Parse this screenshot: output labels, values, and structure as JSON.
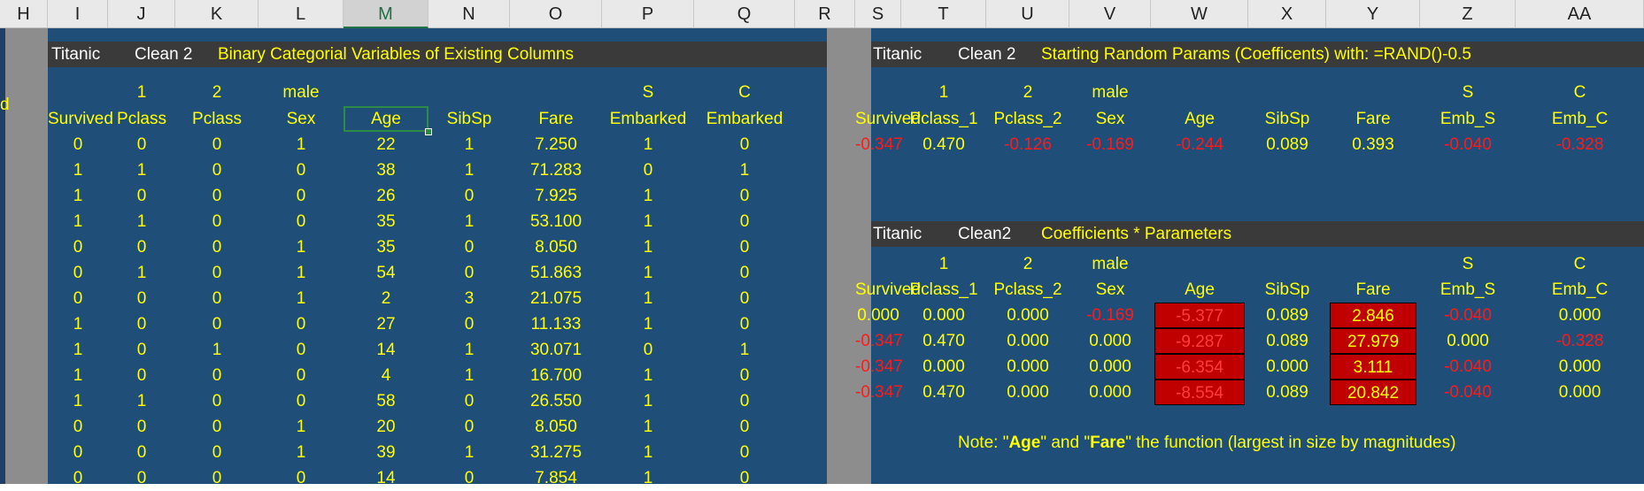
{
  "columns": [
    "H",
    "I",
    "J",
    "K",
    "L",
    "M",
    "N",
    "O",
    "P",
    "Q",
    "R",
    "S",
    "T",
    "U",
    "V",
    "W",
    "X",
    "Y",
    "Z",
    "AA"
  ],
  "selected_column": "M",
  "left_edge_fragment": "d",
  "left_table": {
    "title": [
      "Titanic",
      "Clean 2",
      "Binary Categorial Variables of Existing Columns"
    ],
    "header_row1": [
      "",
      "1",
      "2",
      "male",
      "",
      "",
      "",
      "S",
      "C"
    ],
    "header_row2": [
      "Survived",
      "Pclass",
      "Pclass",
      "Sex",
      "Age",
      "SibSp",
      "Fare",
      "Embarked",
      "Embarked"
    ],
    "rows": [
      [
        "0",
        "0",
        "0",
        "1",
        "22",
        "1",
        "7.250",
        "1",
        "0"
      ],
      [
        "1",
        "1",
        "0",
        "0",
        "38",
        "1",
        "71.283",
        "0",
        "1"
      ],
      [
        "1",
        "0",
        "0",
        "0",
        "26",
        "0",
        "7.925",
        "1",
        "0"
      ],
      [
        "1",
        "1",
        "0",
        "0",
        "35",
        "1",
        "53.100",
        "1",
        "0"
      ],
      [
        "0",
        "0",
        "0",
        "1",
        "35",
        "0",
        "8.050",
        "1",
        "0"
      ],
      [
        "0",
        "1",
        "0",
        "1",
        "54",
        "0",
        "51.863",
        "1",
        "0"
      ],
      [
        "0",
        "0",
        "0",
        "1",
        "2",
        "3",
        "21.075",
        "1",
        "0"
      ],
      [
        "1",
        "0",
        "0",
        "0",
        "27",
        "0",
        "11.133",
        "1",
        "0"
      ],
      [
        "1",
        "0",
        "1",
        "0",
        "14",
        "1",
        "30.071",
        "0",
        "1"
      ],
      [
        "1",
        "0",
        "0",
        "0",
        "4",
        "1",
        "16.700",
        "1",
        "0"
      ],
      [
        "1",
        "1",
        "0",
        "0",
        "58",
        "0",
        "26.550",
        "1",
        "0"
      ],
      [
        "0",
        "0",
        "0",
        "1",
        "20",
        "0",
        "8.050",
        "1",
        "0"
      ],
      [
        "0",
        "0",
        "0",
        "1",
        "39",
        "1",
        "31.275",
        "1",
        "0"
      ],
      [
        "0",
        "0",
        "0",
        "0",
        "14",
        "0",
        "7.854",
        "1",
        "0"
      ]
    ]
  },
  "right_table1": {
    "title": [
      "Titanic",
      "Clean 2",
      "Starting Random Params (Coefficents) with: =RAND()-0.5"
    ],
    "header_row1": [
      "",
      "1",
      "2",
      "male",
      "",
      "",
      "",
      "S",
      "C"
    ],
    "header_row2": [
      "Survived",
      "Pclass_1",
      "Pclass_2",
      "Sex",
      "Age",
      "SibSp",
      "Fare",
      "Emb_S",
      "Emb_C"
    ],
    "values": [
      "-0.347",
      "0.470",
      "-0.126",
      "-0.169",
      "-0.244",
      "0.089",
      "0.393",
      "-0.040",
      "-0.328"
    ]
  },
  "right_table2": {
    "title": [
      "Titanic",
      "Clean2",
      "Coefficients * Parameters"
    ],
    "header_row1": [
      "",
      "1",
      "2",
      "male",
      "",
      "",
      "",
      "S",
      "C"
    ],
    "header_row2": [
      "Survived",
      "Pclass_1",
      "Pclass_2",
      "Sex",
      "Age",
      "SibSp",
      "Fare",
      "Emb_S",
      "Emb_C"
    ],
    "rows": [
      [
        "0.000",
        "0.000",
        "0.000",
        "-0.169",
        "-5.377",
        "0.089",
        "2.846",
        "-0.040",
        "0.000"
      ],
      [
        "-0.347",
        "0.470",
        "0.000",
        "0.000",
        "-9.287",
        "0.089",
        "27.979",
        "0.000",
        "-0.328"
      ],
      [
        "-0.347",
        "0.000",
        "0.000",
        "0.000",
        "-6.354",
        "0.000",
        "3.111",
        "-0.040",
        "0.000"
      ],
      [
        "-0.347",
        "0.470",
        "0.000",
        "0.000",
        "-8.554",
        "0.089",
        "20.842",
        "-0.040",
        "0.000"
      ]
    ]
  },
  "note": {
    "prefix": "Note: \"",
    "w1": "Age",
    "mid": "\" and \"",
    "w2": "Fare",
    "suffix": "\" the function (largest in size by magnitudes)"
  },
  "colors": {
    "navy": "#1f4e79",
    "title_band": "#3a3a3a",
    "yellow_text": "#ffff00",
    "negative_text": "#ff1a1a",
    "highlight_fill": "#c00000",
    "selection_green": "#217346"
  }
}
